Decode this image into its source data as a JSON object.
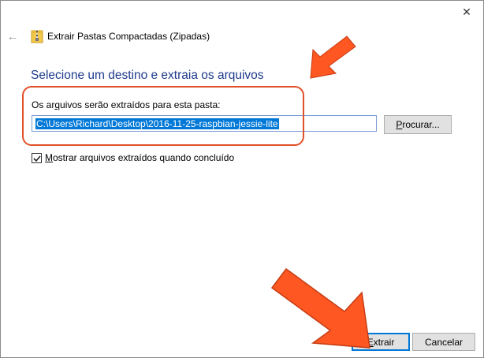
{
  "window": {
    "title": "Extrair Pastas Compactadas (Zipadas)",
    "close_glyph": "✕",
    "back_glyph": "←"
  },
  "main": {
    "heading": "Selecione um destino e extraia os arquivos",
    "label_pre": "Os ar",
    "label_mnemonic": "q",
    "label_post": "uivos serão extraídos para esta pasta:",
    "path_value": "C:\\Users\\Richard\\Desktop\\2016-11-25-raspbian-jessie-lite",
    "browse_mnemonic": "P",
    "browse_rest": "rocurar...",
    "checkbox_checked": true,
    "checkbox_label_mnemonic": "M",
    "checkbox_label_rest": "ostrar arquivos extraídos quando concluído"
  },
  "footer": {
    "extract_mnemonic": "E",
    "extract_rest": "xtrair",
    "cancel_label": "Cancelar"
  },
  "colors": {
    "heading": "#1e3a8c",
    "selection": "#0078d7",
    "annotation": "#ff5722"
  },
  "icons": {
    "zip": "zip-folder-icon",
    "back": "back-arrow-icon",
    "close": "close-icon",
    "check": "checkmark-icon"
  }
}
